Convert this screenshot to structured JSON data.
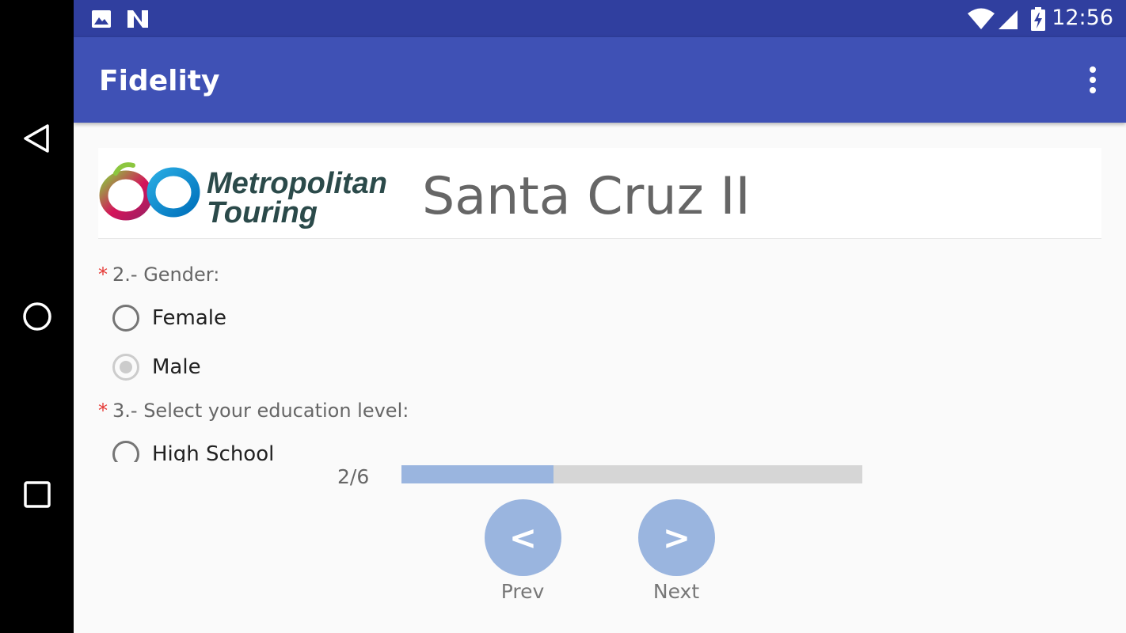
{
  "status_bar": {
    "time": "12:56",
    "icons": [
      "image-icon",
      "n-notification-icon",
      "wifi-icon",
      "cell-signal-icon",
      "battery-charging-icon"
    ]
  },
  "nav_bar": {
    "buttons": [
      "back-triangle-icon",
      "home-circle-icon",
      "recents-square-icon"
    ]
  },
  "app_bar": {
    "title": "Fidelity",
    "overflow_icon": "more-vert-icon"
  },
  "header": {
    "logo_text_line1": "Metropolitan",
    "logo_text_line2": "Touring",
    "title": "Santa Cruz II"
  },
  "questions": [
    {
      "required_mark": "*",
      "label": "2.- Gender:",
      "options": [
        {
          "label": "Female",
          "state": "unselected"
        },
        {
          "label": "Male",
          "state": "disabled"
        }
      ]
    },
    {
      "required_mark": "*",
      "label": "3.- Select your education level:",
      "options": [
        {
          "label": "High School",
          "state": "unselected"
        }
      ]
    }
  ],
  "progress": {
    "text": "2/6",
    "fraction": 0.33
  },
  "navigation": {
    "prev_symbol": "<",
    "prev_label": "Prev",
    "next_symbol": ">",
    "next_label": "Next"
  },
  "colors": {
    "status_bar": "#303f9f",
    "app_bar": "#3f51b5",
    "accent_button": "#9ab5df",
    "required": "#e53935"
  }
}
